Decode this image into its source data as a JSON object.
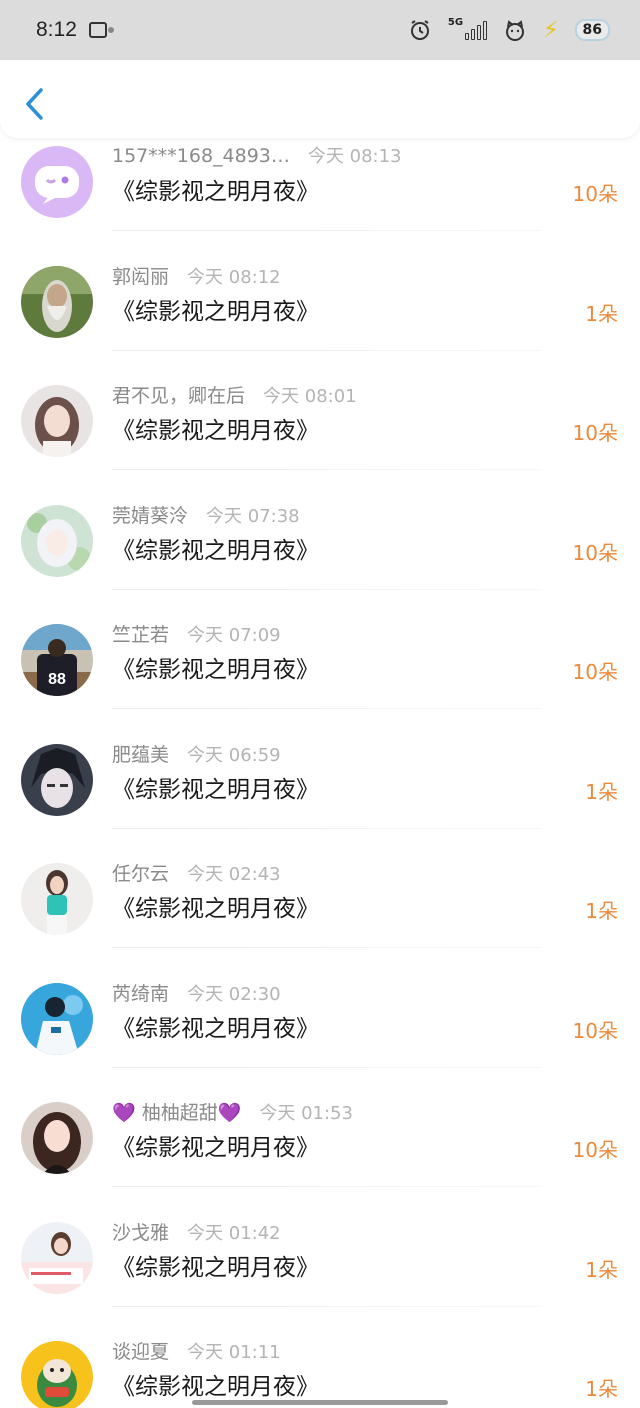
{
  "status_bar": {
    "time": "8:12",
    "network": "5G",
    "battery": "86"
  },
  "colors": {
    "accent_back": "#2f8fd9",
    "count_orange": "#ec8a3c",
    "name_gray": "#8a8a8a",
    "time_gray": "#b4b4b4"
  },
  "list": {
    "items": [
      {
        "name": "157***168_4893…",
        "time": "今天 08:13",
        "title": "《综影视之明月夜》",
        "count": "10朵",
        "avatar": "purple-chat-bubble-avatar"
      },
      {
        "name": "郭闳丽",
        "time": "今天 08:12",
        "title": "《综影视之明月夜》",
        "count": "1朵",
        "avatar": "white-haired-elder-avatar"
      },
      {
        "name": "君不见，卿在后",
        "time": "今天 08:01",
        "title": "《综影视之明月夜》",
        "count": "10朵",
        "avatar": "girl-selfie-avatar"
      },
      {
        "name": "莞婧葵泠",
        "time": "今天 07:38",
        "title": "《综影视之明月夜》",
        "count": "10朵",
        "avatar": "anime-white-hair-avatar"
      },
      {
        "name": "竺芷若",
        "time": "今天 07:09",
        "title": "《综影视之明月夜》",
        "count": "10朵",
        "avatar": "jersey-88-avatar"
      },
      {
        "name": "肥蕴美",
        "time": "今天 06:59",
        "title": "《综影视之明月夜》",
        "count": "1朵",
        "avatar": "anime-dark-boy-avatar"
      },
      {
        "name": "任尔云",
        "time": "今天 02:43",
        "title": "《综影视之明月夜》",
        "count": "1朵",
        "avatar": "girl-teal-top-avatar"
      },
      {
        "name": "芮绮南",
        "time": "今天 02:30",
        "title": "《综影视之明月夜》",
        "count": "10朵",
        "avatar": "boy-blue-sky-avatar"
      },
      {
        "name": "💜 柚柚超甜💜",
        "time": "今天 01:53",
        "title": "《综影视之明月夜》",
        "count": "10朵",
        "avatar": "girl-portrait-avatar"
      },
      {
        "name": "沙戈雅",
        "time": "今天 01:42",
        "title": "《综影视之明月夜》",
        "count": "1朵",
        "avatar": "girl-sign-avatar"
      },
      {
        "name": "谈迎夏",
        "time": "今天 01:11",
        "title": "《综影视之明月夜》",
        "count": "1朵",
        "avatar": "cartoon-yellow-avatar"
      }
    ]
  }
}
